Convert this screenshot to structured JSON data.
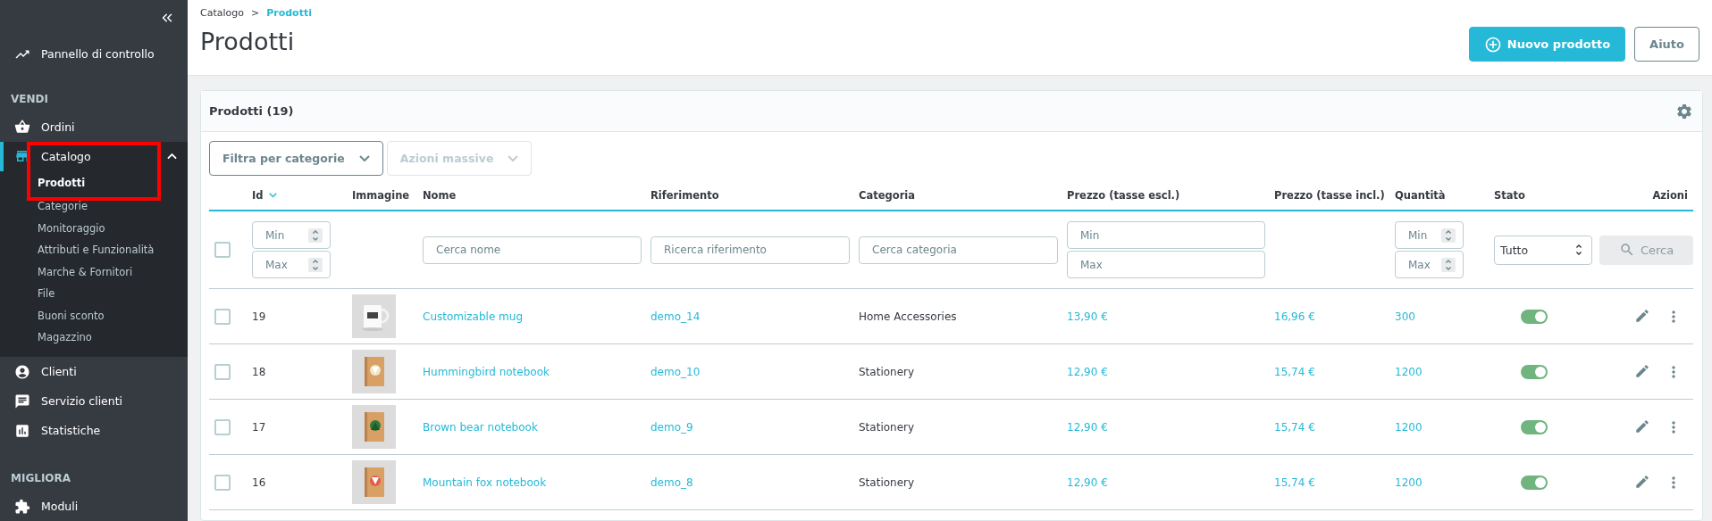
{
  "sidebar": {
    "items": [
      {
        "kind": "link",
        "label": "Pannello di controllo",
        "selected": false
      },
      {
        "kind": "section",
        "label": "VENDI"
      },
      {
        "kind": "link",
        "label": "Ordini",
        "selected": false
      },
      {
        "kind": "link",
        "label": "Catalogo",
        "selected": true,
        "expanded": true,
        "highlighted": true,
        "children": [
          {
            "label": "Prodotti",
            "selected": true
          },
          {
            "label": "Categorie",
            "selected": false
          },
          {
            "label": "Monitoraggio",
            "selected": false
          },
          {
            "label": "Attributi e Funzionalità",
            "selected": false
          },
          {
            "label": "Marche & Fornitori",
            "selected": false
          },
          {
            "label": "File",
            "selected": false
          },
          {
            "label": "Buoni sconto",
            "selected": false
          },
          {
            "label": "Magazzino",
            "selected": false
          }
        ]
      },
      {
        "kind": "link",
        "label": "Clienti",
        "selected": false
      },
      {
        "kind": "link",
        "label": "Servizio clienti",
        "selected": false
      },
      {
        "kind": "link",
        "label": "Statistiche",
        "selected": false
      },
      {
        "kind": "section",
        "label": "MIGLIORA"
      },
      {
        "kind": "link",
        "label": "Moduli",
        "selected": false
      }
    ]
  },
  "breadcrumb": {
    "items": [
      "Catalogo",
      "Prodotti"
    ],
    "separator": ">"
  },
  "page_title": "Prodotti",
  "header_buttons": [
    {
      "kind": "primary",
      "label": "Nuovo prodotto"
    },
    {
      "kind": "outline",
      "label": "Aiuto"
    }
  ],
  "card": {
    "title": "Prodotti (19)",
    "toolbar": [
      {
        "label": "Filtra per categorie",
        "disabled": false
      },
      {
        "label": "Azioni massive",
        "disabled": true
      }
    ],
    "columns": [
      {
        "label": "Id",
        "sorted": true
      },
      {
        "label": "Immagine",
        "sorted": false
      },
      {
        "label": "Nome",
        "sorted": false
      },
      {
        "label": "Riferimento",
        "sorted": false
      },
      {
        "label": "Categoria",
        "sorted": false
      },
      {
        "label": "Prezzo (tasse escl.)",
        "sorted": false
      },
      {
        "label": "Prezzo (tasse incl.)",
        "sorted": false
      },
      {
        "label": "Quantità",
        "sorted": false
      },
      {
        "label": "Stato",
        "sorted": false
      },
      {
        "label": "Azioni",
        "sorted": false
      }
    ],
    "filters": {
      "select_all_checked": false,
      "id_min": "Min",
      "id_max": "Max",
      "name": "Cerca nome",
      "reference": "Ricerca riferimento",
      "category": "Cerca categoria",
      "price_min": "Min",
      "price_max": "Max",
      "quantity_min": "Min",
      "quantity_max": "Max",
      "status": "Tutto",
      "search_button": {
        "label": "Cerca",
        "disabled": true
      }
    },
    "rows": [
      {
        "checked": false,
        "id": "19",
        "name": "Customizable mug",
        "reference": "demo_14",
        "category": "Home Accessories",
        "price_excl": "13,90 €",
        "price_incl": "16,96 €",
        "quantity": "300",
        "active": true
      },
      {
        "checked": false,
        "id": "18",
        "name": "Hummingbird notebook",
        "reference": "demo_10",
        "category": "Stationery",
        "price_excl": "12,90 €",
        "price_incl": "15,74 €",
        "quantity": "1200",
        "active": true
      },
      {
        "checked": false,
        "id": "17",
        "name": "Brown bear notebook",
        "reference": "demo_9",
        "category": "Stationery",
        "price_excl": "12,90 €",
        "price_incl": "15,74 €",
        "quantity": "1200",
        "active": true
      },
      {
        "checked": false,
        "id": "16",
        "name": "Mountain fox notebook",
        "reference": "demo_8",
        "category": "Stationery",
        "price_excl": "12,90 €",
        "price_incl": "15,74 €",
        "quantity": "1200",
        "active": true
      }
    ]
  }
}
